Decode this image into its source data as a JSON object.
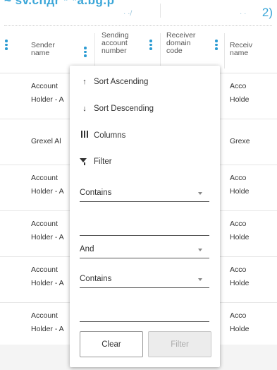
{
  "header": {
    "title_fragment": "~ sv.cnдr *  *a.bg.p",
    "right_fragment": "2)",
    "faint_a": "· ·/",
    "faint_b": "· ·"
  },
  "columns": [
    {
      "label_lines": [
        "Sender",
        "name"
      ]
    },
    {
      "label_lines": [
        "Sending",
        "account",
        "number"
      ]
    },
    {
      "label_lines": [
        "Receiver",
        "domain",
        "code"
      ]
    },
    {
      "label_lines": [
        "Receiv",
        "name"
      ]
    }
  ],
  "rows": [
    {
      "sender": [
        "Account",
        "Holder - A"
      ],
      "receiver": [
        "Acco",
        "Holde"
      ]
    },
    {
      "sender": [
        "Grexel Al"
      ],
      "receiver": [
        "Grexe"
      ]
    },
    {
      "sender": [
        "Account",
        "Holder - A"
      ],
      "receiver": [
        "Acco",
        "Holde"
      ]
    },
    {
      "sender": [
        "Account",
        "Holder - A"
      ],
      "receiver": [
        "Acco",
        "Holde"
      ]
    },
    {
      "sender": [
        "Account",
        "Holder - A"
      ],
      "receiver": [
        "Acco",
        "Holde"
      ]
    },
    {
      "sender": [
        "Account",
        "Holder - A"
      ],
      "receiver": [
        "Acco",
        "Holde"
      ]
    }
  ],
  "menu": {
    "sort_asc": "Sort Ascending",
    "sort_desc": "Sort Descending",
    "columns": "Columns",
    "filter": "Filter",
    "condition1": "Contains",
    "value1": "",
    "operator": "And",
    "condition2": "Contains",
    "value2": "",
    "clear": "Clear",
    "apply": "Filter",
    "icons": {
      "asc": "arrow-up-icon",
      "desc": "arrow-down-icon",
      "columns": "columns-icon",
      "filter": "funnel-icon"
    }
  },
  "colors": {
    "accent": "#2b9bd2",
    "title": "#3aa6d8"
  }
}
